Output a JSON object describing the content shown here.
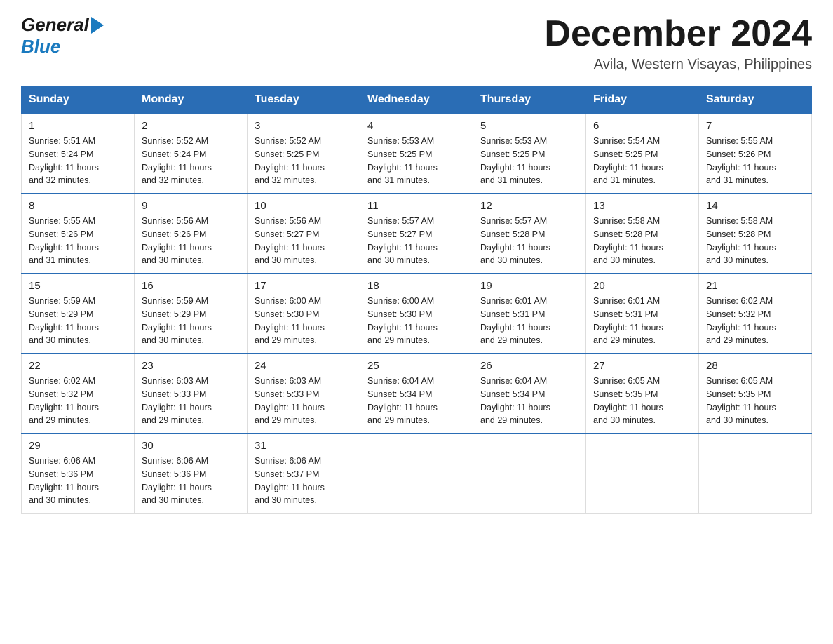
{
  "logo": {
    "general": "General",
    "blue": "Blue"
  },
  "header": {
    "month_year": "December 2024",
    "location": "Avila, Western Visayas, Philippines"
  },
  "weekdays": [
    "Sunday",
    "Monday",
    "Tuesday",
    "Wednesday",
    "Thursday",
    "Friday",
    "Saturday"
  ],
  "weeks": [
    [
      {
        "day": "1",
        "sunrise": "5:51 AM",
        "sunset": "5:24 PM",
        "daylight": "11 hours and 32 minutes."
      },
      {
        "day": "2",
        "sunrise": "5:52 AM",
        "sunset": "5:24 PM",
        "daylight": "11 hours and 32 minutes."
      },
      {
        "day": "3",
        "sunrise": "5:52 AM",
        "sunset": "5:25 PM",
        "daylight": "11 hours and 32 minutes."
      },
      {
        "day": "4",
        "sunrise": "5:53 AM",
        "sunset": "5:25 PM",
        "daylight": "11 hours and 31 minutes."
      },
      {
        "day": "5",
        "sunrise": "5:53 AM",
        "sunset": "5:25 PM",
        "daylight": "11 hours and 31 minutes."
      },
      {
        "day": "6",
        "sunrise": "5:54 AM",
        "sunset": "5:25 PM",
        "daylight": "11 hours and 31 minutes."
      },
      {
        "day": "7",
        "sunrise": "5:55 AM",
        "sunset": "5:26 PM",
        "daylight": "11 hours and 31 minutes."
      }
    ],
    [
      {
        "day": "8",
        "sunrise": "5:55 AM",
        "sunset": "5:26 PM",
        "daylight": "11 hours and 31 minutes."
      },
      {
        "day": "9",
        "sunrise": "5:56 AM",
        "sunset": "5:26 PM",
        "daylight": "11 hours and 30 minutes."
      },
      {
        "day": "10",
        "sunrise": "5:56 AM",
        "sunset": "5:27 PM",
        "daylight": "11 hours and 30 minutes."
      },
      {
        "day": "11",
        "sunrise": "5:57 AM",
        "sunset": "5:27 PM",
        "daylight": "11 hours and 30 minutes."
      },
      {
        "day": "12",
        "sunrise": "5:57 AM",
        "sunset": "5:28 PM",
        "daylight": "11 hours and 30 minutes."
      },
      {
        "day": "13",
        "sunrise": "5:58 AM",
        "sunset": "5:28 PM",
        "daylight": "11 hours and 30 minutes."
      },
      {
        "day": "14",
        "sunrise": "5:58 AM",
        "sunset": "5:28 PM",
        "daylight": "11 hours and 30 minutes."
      }
    ],
    [
      {
        "day": "15",
        "sunrise": "5:59 AM",
        "sunset": "5:29 PM",
        "daylight": "11 hours and 30 minutes."
      },
      {
        "day": "16",
        "sunrise": "5:59 AM",
        "sunset": "5:29 PM",
        "daylight": "11 hours and 30 minutes."
      },
      {
        "day": "17",
        "sunrise": "6:00 AM",
        "sunset": "5:30 PM",
        "daylight": "11 hours and 29 minutes."
      },
      {
        "day": "18",
        "sunrise": "6:00 AM",
        "sunset": "5:30 PM",
        "daylight": "11 hours and 29 minutes."
      },
      {
        "day": "19",
        "sunrise": "6:01 AM",
        "sunset": "5:31 PM",
        "daylight": "11 hours and 29 minutes."
      },
      {
        "day": "20",
        "sunrise": "6:01 AM",
        "sunset": "5:31 PM",
        "daylight": "11 hours and 29 minutes."
      },
      {
        "day": "21",
        "sunrise": "6:02 AM",
        "sunset": "5:32 PM",
        "daylight": "11 hours and 29 minutes."
      }
    ],
    [
      {
        "day": "22",
        "sunrise": "6:02 AM",
        "sunset": "5:32 PM",
        "daylight": "11 hours and 29 minutes."
      },
      {
        "day": "23",
        "sunrise": "6:03 AM",
        "sunset": "5:33 PM",
        "daylight": "11 hours and 29 minutes."
      },
      {
        "day": "24",
        "sunrise": "6:03 AM",
        "sunset": "5:33 PM",
        "daylight": "11 hours and 29 minutes."
      },
      {
        "day": "25",
        "sunrise": "6:04 AM",
        "sunset": "5:34 PM",
        "daylight": "11 hours and 29 minutes."
      },
      {
        "day": "26",
        "sunrise": "6:04 AM",
        "sunset": "5:34 PM",
        "daylight": "11 hours and 29 minutes."
      },
      {
        "day": "27",
        "sunrise": "6:05 AM",
        "sunset": "5:35 PM",
        "daylight": "11 hours and 30 minutes."
      },
      {
        "day": "28",
        "sunrise": "6:05 AM",
        "sunset": "5:35 PM",
        "daylight": "11 hours and 30 minutes."
      }
    ],
    [
      {
        "day": "29",
        "sunrise": "6:06 AM",
        "sunset": "5:36 PM",
        "daylight": "11 hours and 30 minutes."
      },
      {
        "day": "30",
        "sunrise": "6:06 AM",
        "sunset": "5:36 PM",
        "daylight": "11 hours and 30 minutes."
      },
      {
        "day": "31",
        "sunrise": "6:06 AM",
        "sunset": "5:37 PM",
        "daylight": "11 hours and 30 minutes."
      },
      null,
      null,
      null,
      null
    ]
  ],
  "labels": {
    "sunrise": "Sunrise:",
    "sunset": "Sunset:",
    "daylight": "Daylight:"
  }
}
